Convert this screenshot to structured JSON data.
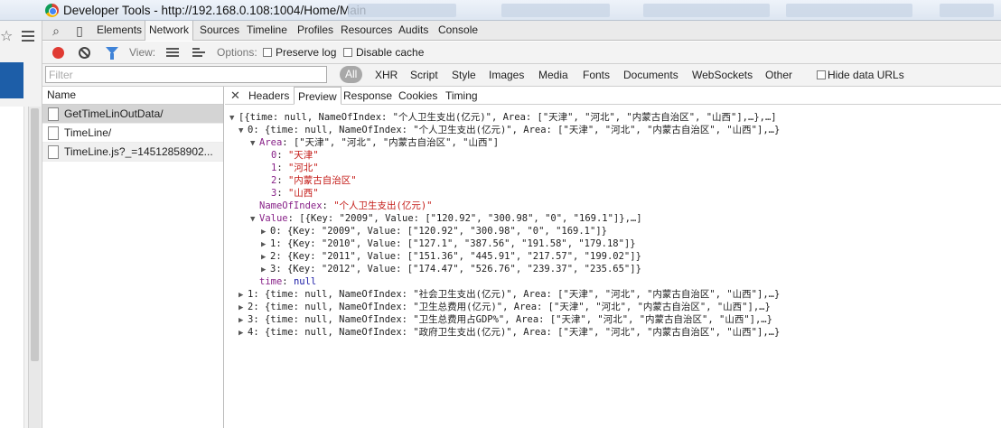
{
  "window": {
    "title": "Developer Tools - http://192.168.0.108:1004/Home/Main"
  },
  "devtools_tabs": [
    "Elements",
    "Network",
    "Sources",
    "Timeline",
    "Profiles",
    "Resources",
    "Audits",
    "Console"
  ],
  "active_tab": "Network",
  "toolbar": {
    "view_label": "View:",
    "options_label": "Options:",
    "preserve_log": "Preserve log",
    "disable_cache": "Disable cache"
  },
  "filter": {
    "placeholder": "Filter",
    "types": [
      "All",
      "XHR",
      "Script",
      "Style",
      "Images",
      "Media",
      "Fonts",
      "Documents",
      "WebSockets",
      "Other"
    ],
    "hide_data_urls": "Hide data URLs"
  },
  "request_list": {
    "header": "Name",
    "rows": [
      "GetTimeLinOutData/",
      "TimeLine/",
      "TimeLine.js?_=14512858902..."
    ]
  },
  "preview_tabs": [
    "Headers",
    "Preview",
    "Response",
    "Cookies",
    "Timing"
  ],
  "active_preview_tab": "Preview",
  "preview": {
    "root": "[{time: null, NameOfIndex: \"个人卫生支出(亿元)\", Area: [\"天津\", \"河北\", \"内蒙古自治区\", \"山西\"],…},…]",
    "item0": "0: {time: null, NameOfIndex: \"个人卫生支出(亿元)\", Area: [\"天津\", \"河北\", \"内蒙古自治区\", \"山西\"],…}",
    "area_key": "Area",
    "area_summary": ": [\"天津\", \"河北\", \"内蒙古自治区\", \"山西\"]",
    "area": [
      {
        "i": "0",
        "v": "\"天津\""
      },
      {
        "i": "1",
        "v": "\"河北\""
      },
      {
        "i": "2",
        "v": "\"内蒙古自治区\""
      },
      {
        "i": "3",
        "v": "\"山西\""
      }
    ],
    "name_key": "NameOfIndex",
    "name_value": "\"个人卫生支出(亿元)\"",
    "value_key": "Value",
    "value_summary": ": [{Key: \"2009\", Value: [\"120.92\", \"300.98\", \"0\", \"169.1\"]},…]",
    "values": [
      "0: {Key: \"2009\", Value: [\"120.92\", \"300.98\", \"0\", \"169.1\"]}",
      "1: {Key: \"2010\", Value: [\"127.1\", \"387.56\", \"191.58\", \"179.18\"]}",
      "2: {Key: \"2011\", Value: [\"151.36\", \"445.91\", \"217.57\", \"199.02\"]}",
      "3: {Key: \"2012\", Value: [\"174.47\", \"526.76\", \"239.37\", \"235.65\"]}"
    ],
    "time_key": "time",
    "time_value": "null",
    "others": [
      "1: {time: null, NameOfIndex: \"社会卫生支出(亿元)\", Area: [\"天津\", \"河北\", \"内蒙古自治区\", \"山西\"],…}",
      "2: {time: null, NameOfIndex: \"卫生总费用(亿元)\", Area: [\"天津\", \"河北\", \"内蒙古自治区\", \"山西\"],…}",
      "3: {time: null, NameOfIndex: \"卫生总费用占GDP%\", Area: [\"天津\", \"河北\", \"内蒙古自治区\", \"山西\"],…}",
      "4: {time: null, NameOfIndex: \"政府卫生支出(亿元)\", Area: [\"天津\", \"河北\", \"内蒙古自治区\", \"山西\"],…}"
    ]
  }
}
